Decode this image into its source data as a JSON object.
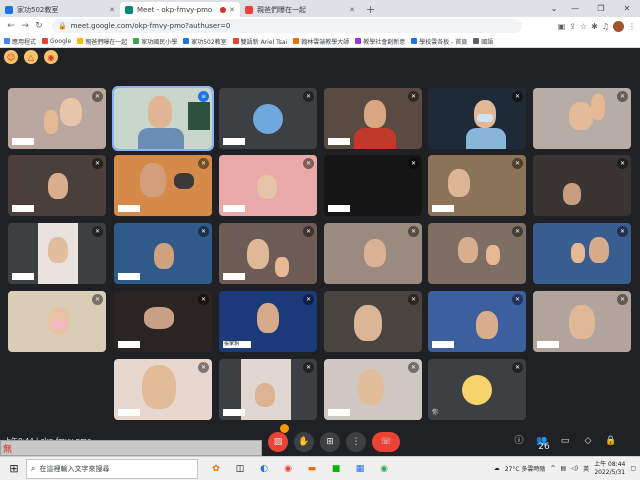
{
  "browser": {
    "tabs": [
      {
        "label": "家功502教室",
        "favicon_color": "#1a73e8",
        "active": false
      },
      {
        "label": "Meet - okp-fmvy-pmo",
        "favicon_color": "#00897b",
        "active": true
      },
      {
        "label": "親爸們曝在一起",
        "favicon_color": "#ea4335",
        "active": false
      }
    ],
    "url": "meet.google.com/okp-fmvy-pmo?authuser=0",
    "bookmarks": [
      "應用程式",
      "Google",
      "親爸們曝在一起",
      "家功國民小學",
      "家功502教室",
      "雙語新 Ariel Tsai",
      "翰林雲端教學大師",
      "教學社會創新意",
      "學校雲各板 - 首頁",
      "國語"
    ]
  },
  "meet": {
    "meeting_code": "上午8:44 | okp-fmvy-pmo",
    "participant_count": "26",
    "reaction_icons": [
      "emoji-icon",
      "warning-icon",
      "info-icon"
    ],
    "name_labels": {
      "r2c4": "",
      "r3c2": "",
      "r5c3": "張家玥",
      "r6c6": "你"
    }
  },
  "taskbar": {
    "search_placeholder": "在這裡輸入文字來搜尋",
    "weather": "27°C 多雲時陰",
    "ime": "英",
    "time": "上午 08:44",
    "date": "2022/5/31"
  },
  "stripe_text": "無"
}
